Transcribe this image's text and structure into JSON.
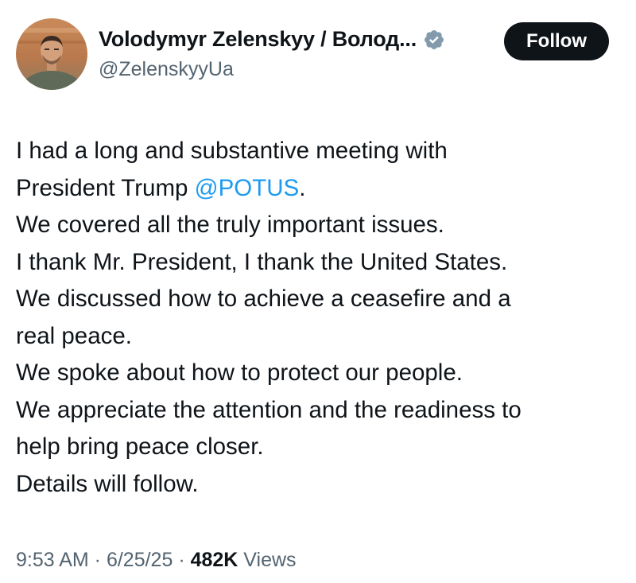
{
  "author": {
    "display_name": "Volodymyr Zelenskyy / Волод...",
    "handle": "@ZelenskyyUa",
    "verified": true,
    "verified_color": "#829aab"
  },
  "follow_button": {
    "label": "Follow"
  },
  "tweet": {
    "line_1": "I had a long and substantive meeting with",
    "line_2_prefix": "President Trump ",
    "mention": "@POTUS",
    "line_2_suffix": ".",
    "line_3": "We covered all the truly important issues.",
    "line_4": "I thank Mr. President, I thank the United States.",
    "line_5": "We discussed how to achieve a ceasefire and a",
    "line_6": "real peace.",
    "line_7": "We spoke about how to protect our people.",
    "line_8": "We appreciate the attention and the readiness to",
    "line_9": "help bring peace closer.",
    "line_10": "Details will follow."
  },
  "meta": {
    "time": "9:53 AM",
    "separator": " · ",
    "date": "6/25/25",
    "views_count": "482K",
    "views_label": " Views"
  },
  "colors": {
    "text": "#0f1419",
    "secondary": "#536471",
    "link": "#1d9bf0",
    "button_bg": "#0f1419"
  }
}
